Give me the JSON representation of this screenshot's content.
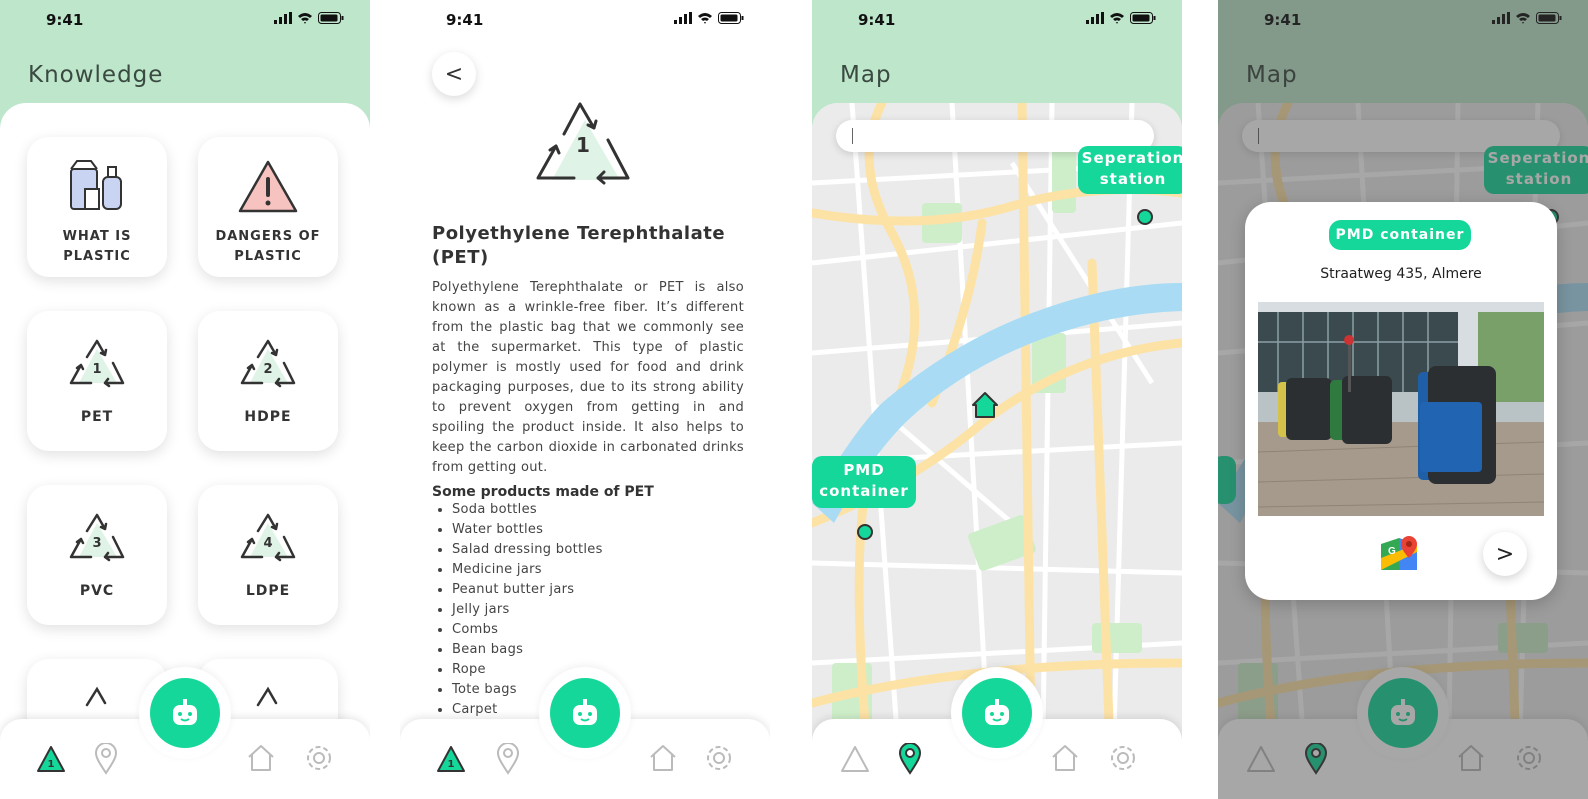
{
  "status": {
    "time": "9:41"
  },
  "knowledge": {
    "title": "Knowledge",
    "cards": [
      {
        "label": "WHAT IS\nPLASTIC",
        "icon": "plastic-items-icon"
      },
      {
        "label": "DANGERS OF\nPLASTIC",
        "icon": "warning-icon"
      },
      {
        "label": "PET",
        "icon": "recycle-1-icon",
        "number": "1"
      },
      {
        "label": "HDPE",
        "icon": "recycle-2-icon",
        "number": "2"
      },
      {
        "label": "PVC",
        "icon": "recycle-3-icon",
        "number": "3"
      },
      {
        "label": "LDPE",
        "icon": "recycle-4-icon",
        "number": "4"
      }
    ]
  },
  "detail": {
    "back": "<",
    "number": "1",
    "title": "Polyethylene Terephthalate (PET)",
    "description": "Polyethylene Terephthalate or PET is also known as a wrinkle-free fiber. It’s different from the plastic bag that we commonly see at the supermarket. This type of plastic polymer is mostly used for food and drink packaging purposes, due to its strong ability to prevent oxygen from getting in and spoiling the product inside. It also helps to keep the carbon dioxide in carbonated drinks from getting out.",
    "products_heading": "Some products made of PET",
    "products": [
      "Soda bottles",
      "Water bottles",
      "Salad dressing bottles",
      "Medicine jars",
      "Peanut butter jars",
      "Jelly jars",
      "Combs",
      "Bean bags",
      "Rope",
      "Tote bags",
      "Carpet"
    ]
  },
  "map": {
    "title": "Map",
    "search_placeholder": "",
    "markers": [
      {
        "label_line1": "Seperation",
        "label_line2": "station"
      },
      {
        "label_line1": "PMD",
        "label_line2": "container"
      }
    ]
  },
  "popup": {
    "chip": "PMD container",
    "address": "Straatweg 435, Almere",
    "next": ">"
  },
  "colors": {
    "accent": "#16d79a",
    "header": "#bde6cb",
    "road": "#fde2a6",
    "river": "#a9dcf4",
    "park": "#cdeec9"
  }
}
